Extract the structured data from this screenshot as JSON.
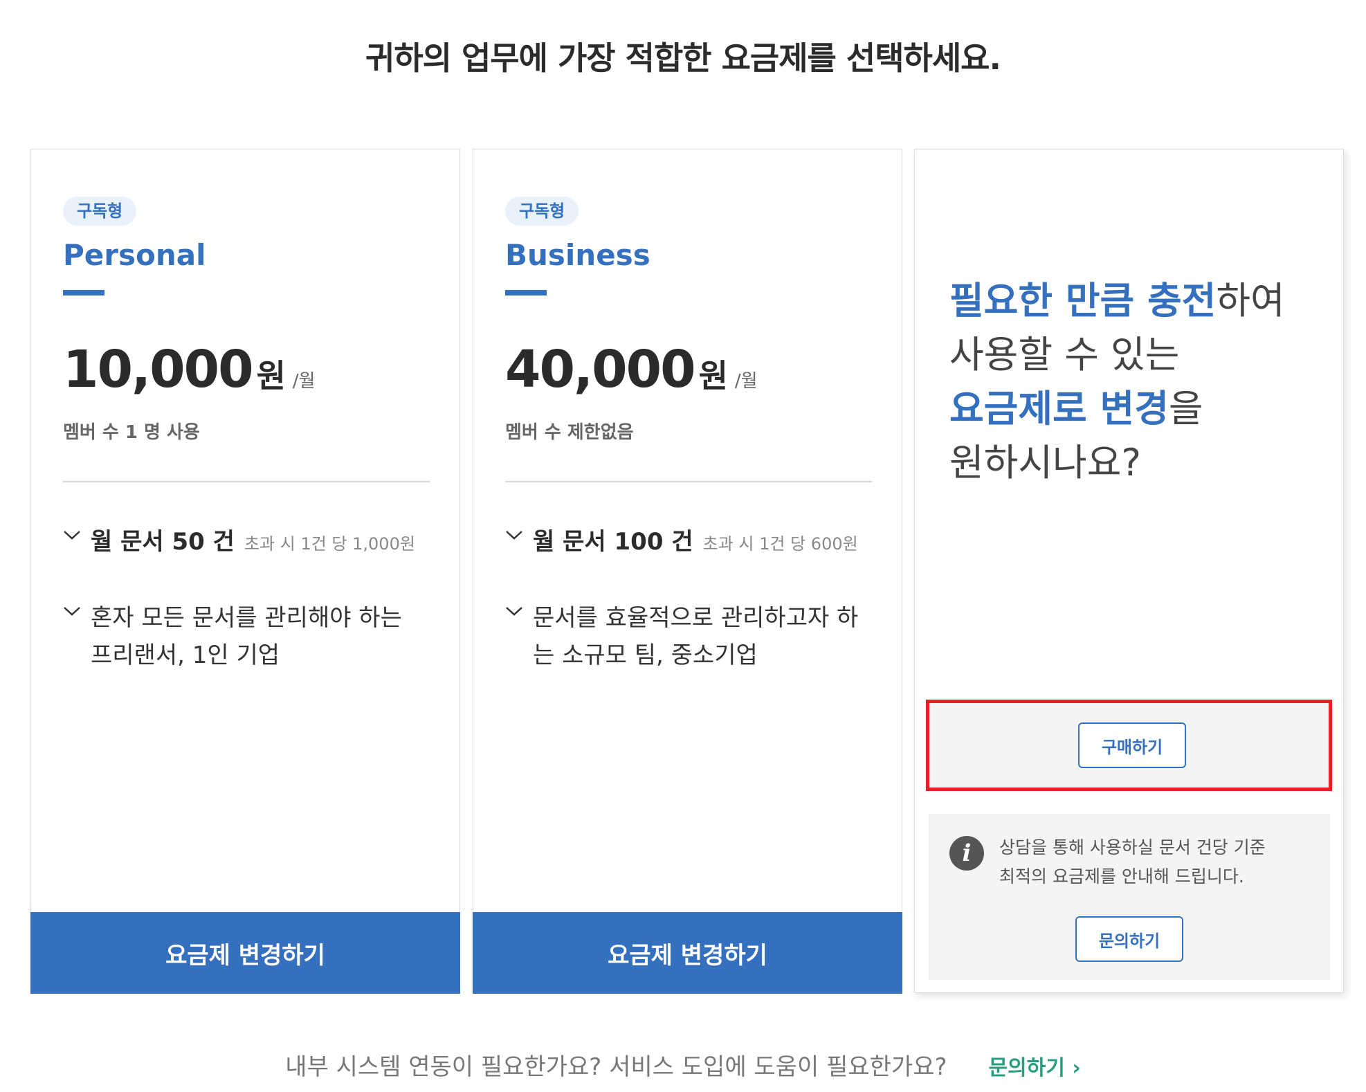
{
  "page": {
    "title": "귀하의 업무에 가장 적합한 요금제를 선택하세요."
  },
  "plans": [
    {
      "badge": "구독형",
      "name": "Personal",
      "price": "10,000",
      "currency": "원",
      "period": "/월",
      "members": "멤버 수 1 명 사용",
      "feature1_main": "월 문서 50 건",
      "feature1_note": "초과 시 1건 당 1,000원",
      "feature2_line1": "혼자 모든 문서를 관리해야 하는",
      "feature2_line2": "프리랜서, 1인 기업",
      "cta_label": "요금제 변경하기"
    },
    {
      "badge": "구독형",
      "name": "Business",
      "price": "40,000",
      "currency": "원",
      "period": "/월",
      "members": "멤버 수 제한없음",
      "feature1_main": "월 문서 100 건",
      "feature1_note": "초과 시 1건 당 600원",
      "feature2_line1": "문서를 효율적으로 관리하고자 하",
      "feature2_line2": "는 소규모 팀, 중소기업",
      "cta_label": "요금제 변경하기"
    }
  ],
  "prepaid": {
    "headline_hl1": "필요한 만큼 충전",
    "headline_t1": "하여",
    "headline_t2": "사용할 수 있는",
    "headline_hl2": "요금제로 변경",
    "headline_t3": "을",
    "headline_t4": "원하시나요?",
    "buy_label": "구매하기",
    "info_line1": "상담을 통해 사용하실 문서 건당 기준",
    "info_line2": "최적의 요금제를 안내해 드립니다.",
    "ask_label": "문의하기",
    "icons": {
      "info": "info-icon",
      "check": "check-icon",
      "chevron": "chevron-right-icon"
    }
  },
  "footer": {
    "question": "내부 시스템 연동이 필요한가요? 서비스 도입에 도움이 필요한가요?",
    "link_label": "문의하기",
    "link_arrow": "›"
  },
  "colors": {
    "brand_blue": "#3570be",
    "highlight_red": "#e02424",
    "link_green": "#2a9d7f"
  }
}
